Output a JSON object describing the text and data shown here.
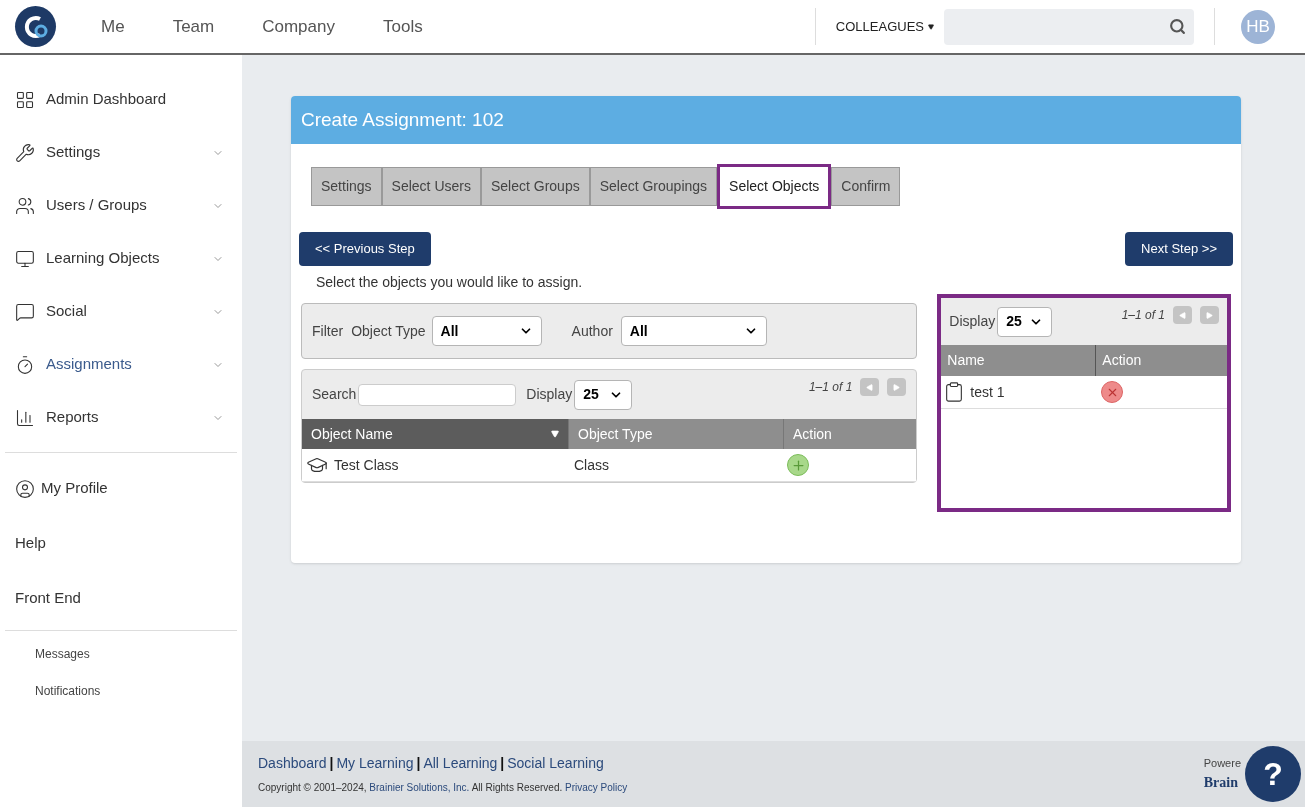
{
  "topnav": {
    "items": [
      "Me",
      "Team",
      "Company",
      "Tools"
    ],
    "colleagues": "COLLEAGUES",
    "avatar": "HB"
  },
  "sidebar": {
    "items": [
      {
        "label": "Admin Dashboard",
        "expandable": false,
        "selected": false
      },
      {
        "label": "Settings",
        "expandable": true,
        "selected": false
      },
      {
        "label": "Users / Groups",
        "expandable": true,
        "selected": false
      },
      {
        "label": "Learning Objects",
        "expandable": true,
        "selected": false
      },
      {
        "label": "Social",
        "expandable": true,
        "selected": false
      },
      {
        "label": "Assignments",
        "expandable": true,
        "selected": true
      },
      {
        "label": "Reports",
        "expandable": true,
        "selected": false
      }
    ],
    "profile_items": [
      "My Profile",
      "Help",
      "Front End"
    ],
    "sub_items": [
      "Messages",
      "Notifications"
    ]
  },
  "card": {
    "title": "Create Assignment: 102",
    "tabs": [
      {
        "label": "Settings",
        "selected": false
      },
      {
        "label": "Select Users",
        "selected": false
      },
      {
        "label": "Select Groups",
        "selected": false
      },
      {
        "label": "Select Groupings",
        "selected": false
      },
      {
        "label": "Select Objects",
        "selected": true
      },
      {
        "label": "Confirm",
        "selected": false
      }
    ],
    "prev_button": "<< Previous Step",
    "next_button": "Next Step >>",
    "instruction": "Select the objects you would like to assign.",
    "filter": {
      "label": "Filter",
      "object_type_label": "Object Type",
      "object_type_value": "All",
      "author_label": "Author",
      "author_value": "All"
    },
    "objects": {
      "search_label": "Search",
      "display_label": "Display",
      "display_value": "25",
      "paging": "1–1 of 1",
      "columns": [
        {
          "label": "Object Name",
          "sorted": true
        },
        {
          "label": "Object Type",
          "sorted": false
        },
        {
          "label": "Action",
          "sorted": false
        }
      ],
      "rows": [
        {
          "name": "Test Class",
          "type": "Class"
        }
      ]
    },
    "selected": {
      "display_label": "Display",
      "display_value": "25",
      "paging": "1–1 of 1",
      "columns": [
        "Name",
        "Action"
      ],
      "rows": [
        {
          "name": "test 1"
        }
      ]
    }
  },
  "footer": {
    "nav": [
      {
        "kind": "link",
        "text": "Dashboard"
      },
      {
        "kind": "separator",
        "text": "|"
      },
      {
        "kind": "link",
        "text": "My Learning"
      },
      {
        "kind": "separator",
        "text": "|"
      },
      {
        "kind": "link",
        "text": "All Learning"
      },
      {
        "kind": "separator",
        "text": "|"
      },
      {
        "kind": "link",
        "text": "Social Learning"
      }
    ],
    "copyright": "Copyright © 2001–2024,",
    "company": "Brainier Solutions, Inc.",
    "rights": "All Rights Reserved.",
    "privacy": "Privacy Policy",
    "powered": "Powere",
    "logo": "Brain",
    "help": "?"
  }
}
